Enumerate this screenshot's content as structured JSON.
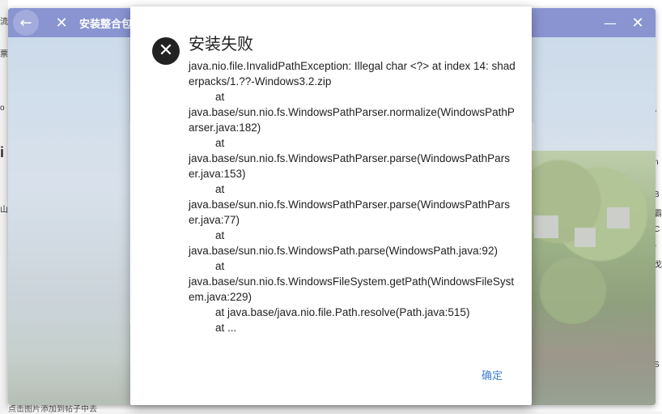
{
  "window": {
    "title": "安装整合包",
    "back_icon": "←",
    "close_icon": "✕",
    "minimize_icon": "—",
    "window_close_icon": "✕"
  },
  "dialog": {
    "title": "安装失败",
    "error_icon": "✕",
    "message_lines": [
      {
        "text": "java.nio.file.InvalidPathException: Illegal char <?> at index 14: shaderpacks/1.??-Windows3.2.zip",
        "indent": false
      },
      {
        "text": "at",
        "indent": true
      },
      {
        "text": "java.base/sun.nio.fs.WindowsPathParser.normalize(WindowsPathParser.java:182)",
        "indent": false
      },
      {
        "text": "at",
        "indent": true
      },
      {
        "text": "java.base/sun.nio.fs.WindowsPathParser.parse(WindowsPathParser.java:153)",
        "indent": false
      },
      {
        "text": "at",
        "indent": true
      },
      {
        "text": "java.base/sun.nio.fs.WindowsPathParser.parse(WindowsPathParser.java:77)",
        "indent": false
      },
      {
        "text": "at",
        "indent": true
      },
      {
        "text": "java.base/sun.nio.fs.WindowsPath.parse(WindowsPath.java:92)",
        "indent": false
      },
      {
        "text": "at",
        "indent": true
      },
      {
        "text": "java.base/sun.nio.fs.WindowsFileSystem.getPath(WindowsFileSystem.java:229)",
        "indent": false
      },
      {
        "text": "at java.base/java.nio.file.Path.resolve(Path.java:515)",
        "indent": true
      },
      {
        "text": "at ...",
        "indent": true
      }
    ],
    "ok_label": "确定"
  },
  "background": {
    "left_fragments": [
      "流",
      "o",
      "票",
      "i",
      "山"
    ],
    "right_fragments": [
      "\\",
      "n",
      "B",
      "霸",
      "C",
      "-",
      "戈",
      "S"
    ],
    "bottom_text": "点击图片添加到帖子中去"
  },
  "colors": {
    "titlebar": "#5c6bc0",
    "accent_link": "#3f7fd0",
    "error_icon": "#222222"
  }
}
